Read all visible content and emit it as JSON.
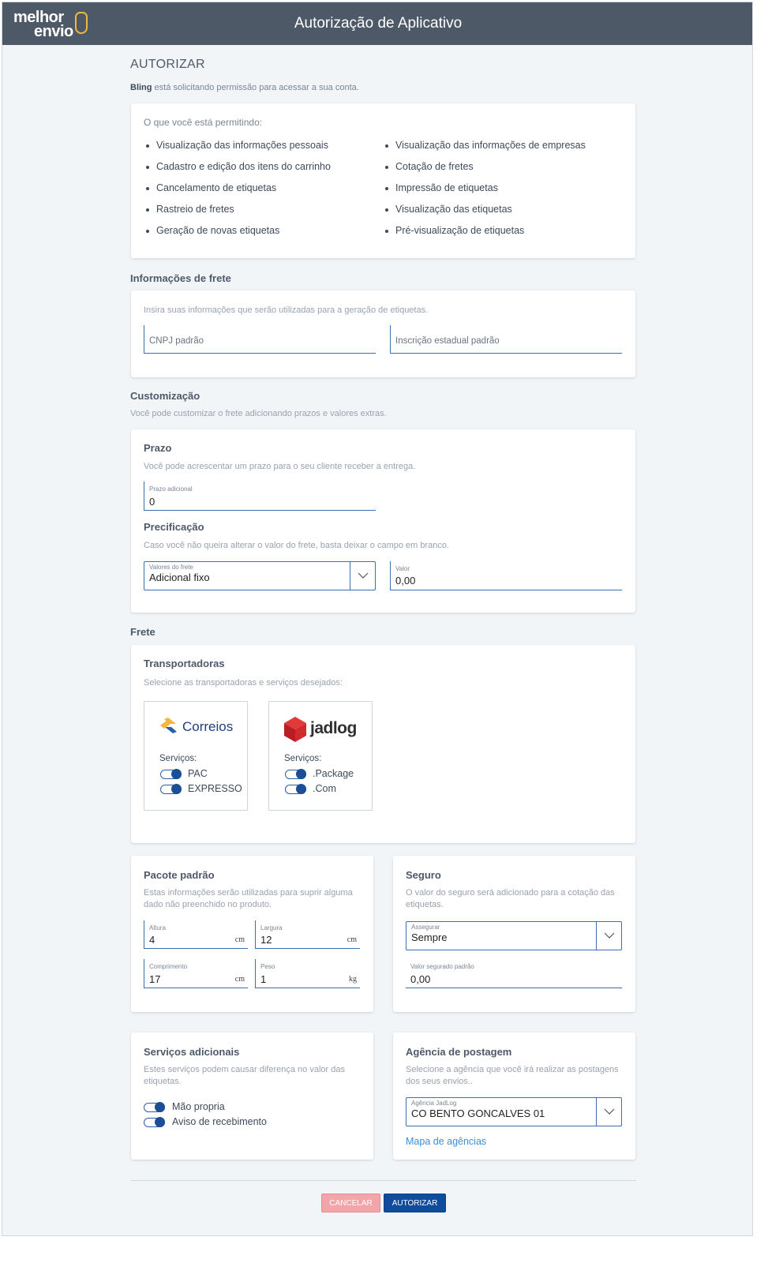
{
  "header": {
    "title": "Autorização de Aplicativo",
    "logo_line1": "melhor",
    "logo_line2": "envio"
  },
  "authorize": {
    "heading": "AUTORIZAR",
    "app_name": "Bling",
    "request_text": " está solicitando permissão para acessar a sua conta.",
    "permissions_label": "O que você está permitindo:",
    "permissions_left": [
      "Visualização das informações pessoais",
      "Cadastro e edição dos itens do carrinho",
      "Cancelamento de etiquetas",
      "Rastreio de fretes",
      "Geração de novas etiquetas"
    ],
    "permissions_right": [
      "Visualização das informações de empresas",
      "Cotação de fretes",
      "Impressão de etiquetas",
      "Visualização das etiquetas",
      "Pré-visualização de etiquetas"
    ]
  },
  "shipping_info": {
    "title": "Informações de frete",
    "description": "Insira suas informações que serão utilizadas para a geração de etiquetas.",
    "cnpj_placeholder": "CNPJ padrão",
    "ie_placeholder": "Inscrição estadual padrão"
  },
  "customization": {
    "title": "Customização",
    "description": "Você pode customizar o frete adicionando prazos e valores extras.",
    "prazo_title": "Prazo",
    "prazo_desc": "Você pode acrescentar um prazo para o seu cliente receber a entrega.",
    "prazo_label": "Prazo adicional",
    "prazo_value": "0",
    "pricing_title": "Precificação",
    "pricing_desc": "Caso você não queira alterar o valor do frete, basta deixar o campo em branco.",
    "freight_values_label": "Valores do frete",
    "freight_values_selected": "Adicional fixo",
    "value_label": "Valor",
    "value_value": "0,00"
  },
  "freight": {
    "title": "Frete",
    "carriers_title": "Transportadoras",
    "carriers_desc": "Selecione as transportadoras e serviços desejados:",
    "services_label": "Serviços:",
    "carriers": [
      {
        "name": "Correios",
        "services": [
          "PAC",
          "EXPRESSO"
        ]
      },
      {
        "name": "jadlog",
        "services": [
          ".Package",
          ".Com"
        ]
      }
    ]
  },
  "package": {
    "title": "Pacote padrão",
    "desc": "Estas informações serão utilizadas para suprir alguma dado não preenchido no produto.",
    "height_label": "Altura",
    "height_value": "4",
    "height_unit": "cm",
    "width_label": "Largura",
    "width_value": "12",
    "width_unit": "cm",
    "length_label": "Comprimento",
    "length_value": "17",
    "length_unit": "cm",
    "weight_label": "Peso",
    "weight_value": "1",
    "weight_unit": "kg"
  },
  "insurance": {
    "title": "Seguro",
    "desc": "O valor do seguro será adicionado para a cotação das etiquetas.",
    "insure_label": "Assegurar",
    "insure_selected": "Sempre",
    "insured_value_label": "Valor segurado padrão",
    "insured_value": "0,00"
  },
  "extra_services": {
    "title": "Serviços adicionais",
    "desc": "Estes serviços podem causar diferença no valor das etiquetas.",
    "items": [
      "Mão propria",
      "Aviso de recebimento"
    ]
  },
  "agency": {
    "title": "Agência de postagem",
    "desc": "Selecione a agência que você irá realizar as postagens dos seus envios..",
    "agency_label": "Agência JadLog",
    "agency_selected": "CO BENTO GONCALVES 01",
    "map_link": "Mapa de agências"
  },
  "actions": {
    "cancel": "CANCELAR",
    "authorize": "AUTORIZAR"
  },
  "colors": {
    "header": "#4e5968",
    "accent": "#0f4c9e",
    "cancel": "#f2a5a9",
    "link": "#3a8fd9"
  }
}
